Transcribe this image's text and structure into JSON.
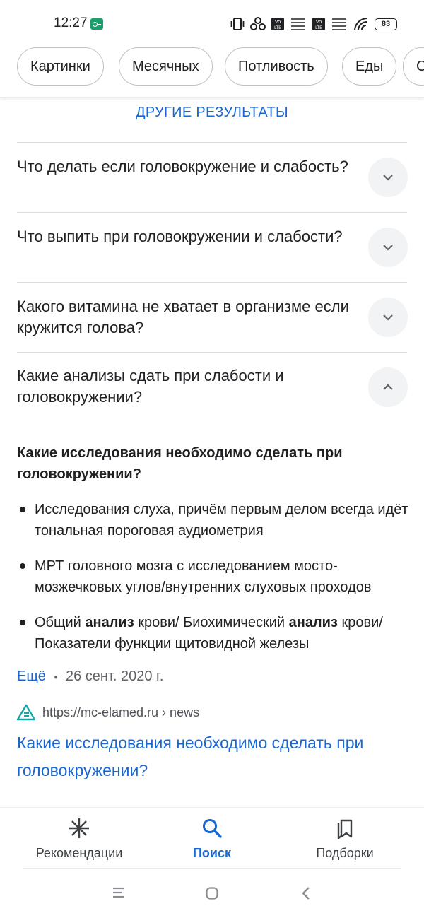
{
  "status_bar": {
    "time": "12:27",
    "battery": "83",
    "icons": [
      "key-icon",
      "vibrate-icon",
      "hotspot-icon",
      "volte-icon",
      "signal-icon",
      "volte-icon",
      "signal-icon",
      "wifi-icon",
      "battery-icon"
    ]
  },
  "chips": [
    "Картинки",
    "Месячных",
    "Потливость",
    "Еды",
    "С"
  ],
  "section_heading": "ДРУГИЕ РЕЗУЛЬТАТЫ",
  "questions": [
    {
      "text": "Что делать если головокружение и слабость?",
      "expanded": false
    },
    {
      "text": "Что выпить при головокружении и слабости?",
      "expanded": false
    },
    {
      "text": "Какого витамина не хватает в организме если кружится голова?",
      "expanded": false
    },
    {
      "text": "Какие анализы сдать при слабости и головокружении?",
      "expanded": true
    }
  ],
  "answer": {
    "title": "Какие исследования необходимо сделать при головокружении?",
    "bullets": [
      {
        "parts": [
          "Исследования слуха, причём первым делом всегда идёт тональная пороговая аудиометрия"
        ]
      },
      {
        "parts": [
          "МРТ головного мозга с исследованием мосто-мозжечковых углов/внутренних слуховых проходов"
        ]
      },
      {
        "parts": [
          "Общий ",
          "анализ",
          " крови/ Биохимический ",
          "анализ",
          " крови/ Показатели функции щитовидной железы"
        ]
      }
    ],
    "more_link": "Ещё",
    "separator": "•",
    "date": "26 сент. 2020 г.",
    "source_url": "https://mc-elamed.ru › news",
    "result_title": "Какие исследования необходимо сделать при головокружении?"
  },
  "bottom_nav": [
    {
      "label": "Рекомендации",
      "icon": "asterisk-icon",
      "active": false
    },
    {
      "label": "Поиск",
      "icon": "search-icon",
      "active": true
    },
    {
      "label": "Подборки",
      "icon": "collections-icon",
      "active": false
    }
  ],
  "system_nav": [
    "menu-icon",
    "home-icon",
    "back-icon"
  ],
  "colors": {
    "accent": "#1967d2",
    "text": "#202124",
    "secondary_text": "#5f6368",
    "button_bg": "#f1f3f4",
    "divider": "#dadce0",
    "site_logo": "#1aa3a3"
  }
}
